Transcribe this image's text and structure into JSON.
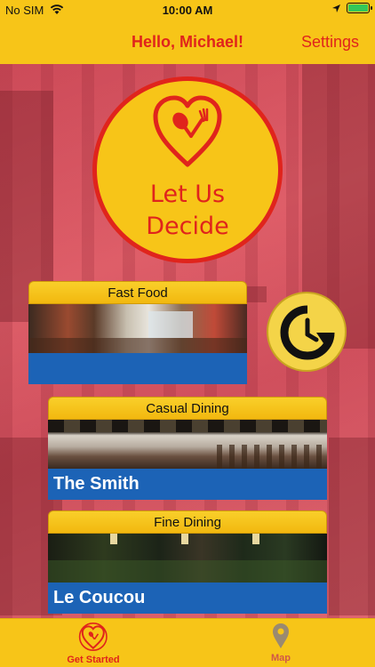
{
  "status_bar": {
    "carrier": "No SIM",
    "time": "10:00 AM"
  },
  "nav": {
    "greeting": "Hello, Michael!",
    "settings_label": "Settings"
  },
  "decide_button": {
    "line1": "Let Us",
    "line2": "Decide"
  },
  "cards": [
    {
      "category": "Fast Food",
      "restaurant": ""
    },
    {
      "category": "Casual Dining",
      "restaurant": "The Smith"
    },
    {
      "category": "Fine Dining",
      "restaurant": "Le Coucou"
    }
  ],
  "tab_bar": {
    "items": [
      {
        "label": "Get Started",
        "icon": "heart-fork-spoon-icon",
        "active": true
      },
      {
        "label": "Map",
        "icon": "map-pin-icon",
        "active": false
      }
    ]
  },
  "colors": {
    "brand_yellow": "#f7c518",
    "brand_red": "#e0241c",
    "card_blue": "#1c63b6",
    "background_tint": "#d8525e"
  }
}
